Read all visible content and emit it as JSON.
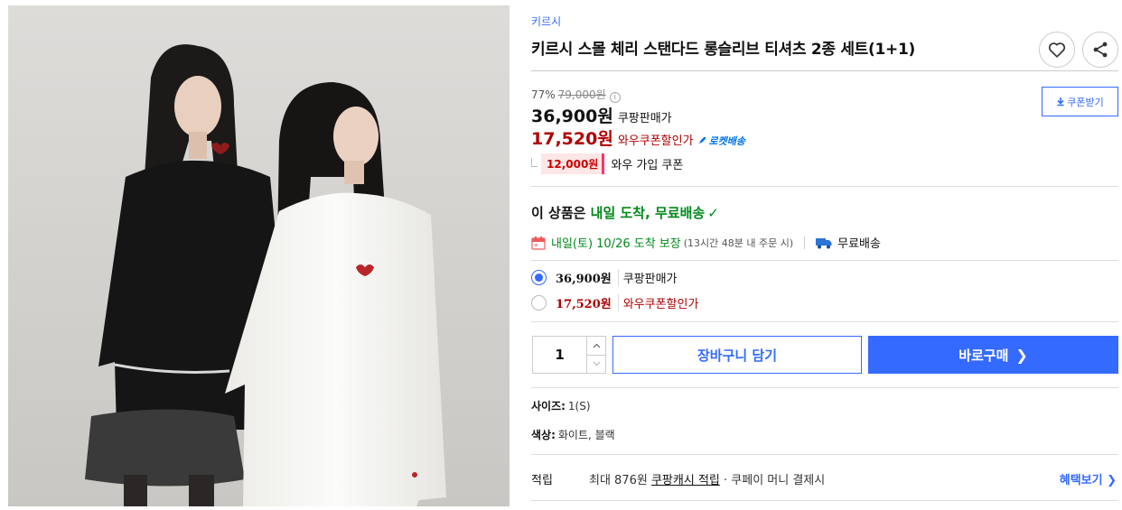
{
  "product": {
    "brand": "키르시",
    "title": "키르시 스몰 체리 스탠다드 롱슬리브 티셔츠 2종 세트(1+1)",
    "image_alt": "two models wearing black and white long sleeve t-shirts"
  },
  "actions": {
    "wish_icon": "heart-icon",
    "share_icon": "share-icon",
    "coupon_label": "쿠폰받기"
  },
  "pricing": {
    "discount_rate": "77%",
    "original_price": "79,000원",
    "sale_price": "36,900원",
    "sale_label": "쿠팡판매가",
    "wow_price": "17,520원",
    "wow_label": "와우쿠폰할인가",
    "rocket_badge": "로켓배송",
    "wow_coupon_amount": "12,000원",
    "wow_coupon_label": "와우 가입 쿠폰"
  },
  "delivery": {
    "headline_prefix": "이 상품은 ",
    "headline_green": "내일 도착, 무료배송",
    "checkmark": "✓",
    "date_text": "내일(토) 10/26 도착 보장",
    "cutoff_text": "(13시간 48분 내 주문 시)",
    "shipping_text": "무료배송"
  },
  "options": [
    {
      "price": "36,900원",
      "label": "쿠팡판매가",
      "selected": true
    },
    {
      "price": "17,520원",
      "label": "와우쿠폰할인가",
      "selected": false
    }
  ],
  "purchase": {
    "quantity": "1",
    "add_to_cart": "장바구니 담기",
    "buy_now": "바로구매",
    "buy_chevron": "❯"
  },
  "attributes": {
    "size_key": "사이즈:",
    "size_val": "1(S)",
    "color_key": "색상:",
    "color_val": "화이트, 블랙"
  },
  "reward": {
    "key": "적립",
    "prefix": "최대 876원 ",
    "link": "쿠팡캐시 적립",
    "suffix": " · 쿠페이 머니 결제시",
    "more": "혜택보기 ❯"
  },
  "colors": {
    "accent": "#346aff",
    "wow_red": "#ae0000",
    "delivery_green": "#00891a"
  }
}
